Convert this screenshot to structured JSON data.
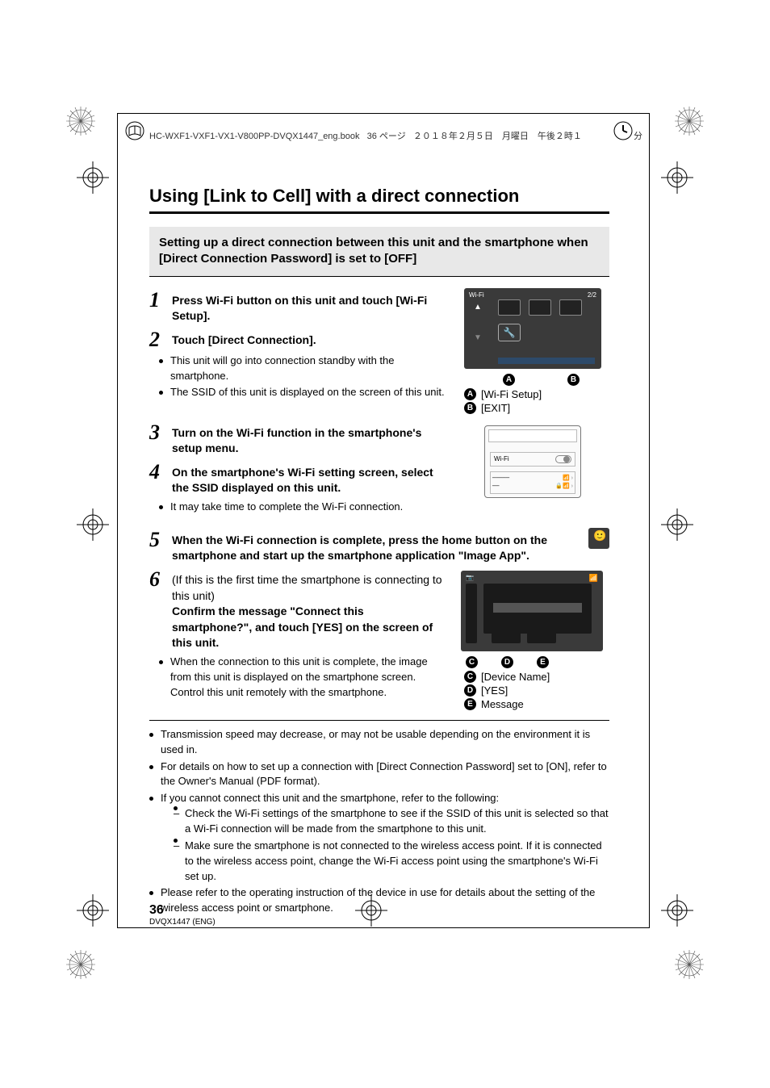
{
  "header": {
    "filename": "HC-WXF1-VXF1-VX1-V800PP-DVQX1447_eng.book",
    "page_info": "36 ページ",
    "date": "２０１８年２月５日　月曜日　午後２時１",
    "suffix": "分"
  },
  "title": "Using [Link to Cell] with a direct connection",
  "subhead": "Setting up a direct connection between this unit and the smartphone when [Direct Connection Password] is set to [OFF]",
  "steps": {
    "s1": "Press Wi-Fi button on this unit and touch [Wi-Fi Setup].",
    "s2": "Touch [Direct Connection].",
    "s2_bullets": [
      "This unit will go into connection standby with the smartphone.",
      "The SSID of this unit is displayed on the screen of this unit."
    ],
    "s3": "Turn on the Wi-Fi function in the smartphone's setup menu.",
    "s4": "On the smartphone's Wi-Fi setting screen, select the SSID displayed on this unit.",
    "s4_bullets": [
      "It may take time to complete the Wi-Fi connection."
    ],
    "s5": "When the Wi-Fi connection is complete, press the home button on the smartphone and start up the smartphone application \"Image App\".",
    "s6_a": "(If this is the first time the smartphone is connecting to this unit)",
    "s6_b": "Confirm the message \"Connect this smartphone?\", and touch [YES] on the screen of this unit.",
    "s6_bullets": [
      "When the connection to this unit is complete, the image from this unit is displayed on the smartphone screen. Control this unit remotely with the smartphone."
    ]
  },
  "screen1": {
    "wifi_label": "Wi-Fi",
    "page": "2/2"
  },
  "labels_ab": {
    "a": "[Wi-Fi Setup]",
    "b": "[EXIT]"
  },
  "phone": {
    "wifi": "Wi-Fi"
  },
  "labels_cde": {
    "c": "[Device Name]",
    "d": "[YES]",
    "e": "Message"
  },
  "notes": [
    "Transmission speed may decrease, or may not be usable depending on the environment it is used in.",
    "For details on how to set up a connection with [Direct Connection Password] set to [ON], refer to the Owner's Manual (PDF format).",
    "If you cannot connect this unit and the smartphone, refer to the following:",
    "Please refer to the operating instruction of the device in use for details about the setting of the wireless access point or smartphone."
  ],
  "notes_sub": [
    "Check the Wi-Fi settings of the smartphone to see if the SSID of this unit is selected so that a Wi-Fi connection will be made from the smartphone to this unit.",
    "Make sure the smartphone is not connected to the wireless access point. If it is connected to the wireless access point, change the Wi-Fi access point using the smartphone's Wi-Fi set up."
  ],
  "footer": {
    "page": "36",
    "code": "DVQX1447 (ENG)"
  }
}
